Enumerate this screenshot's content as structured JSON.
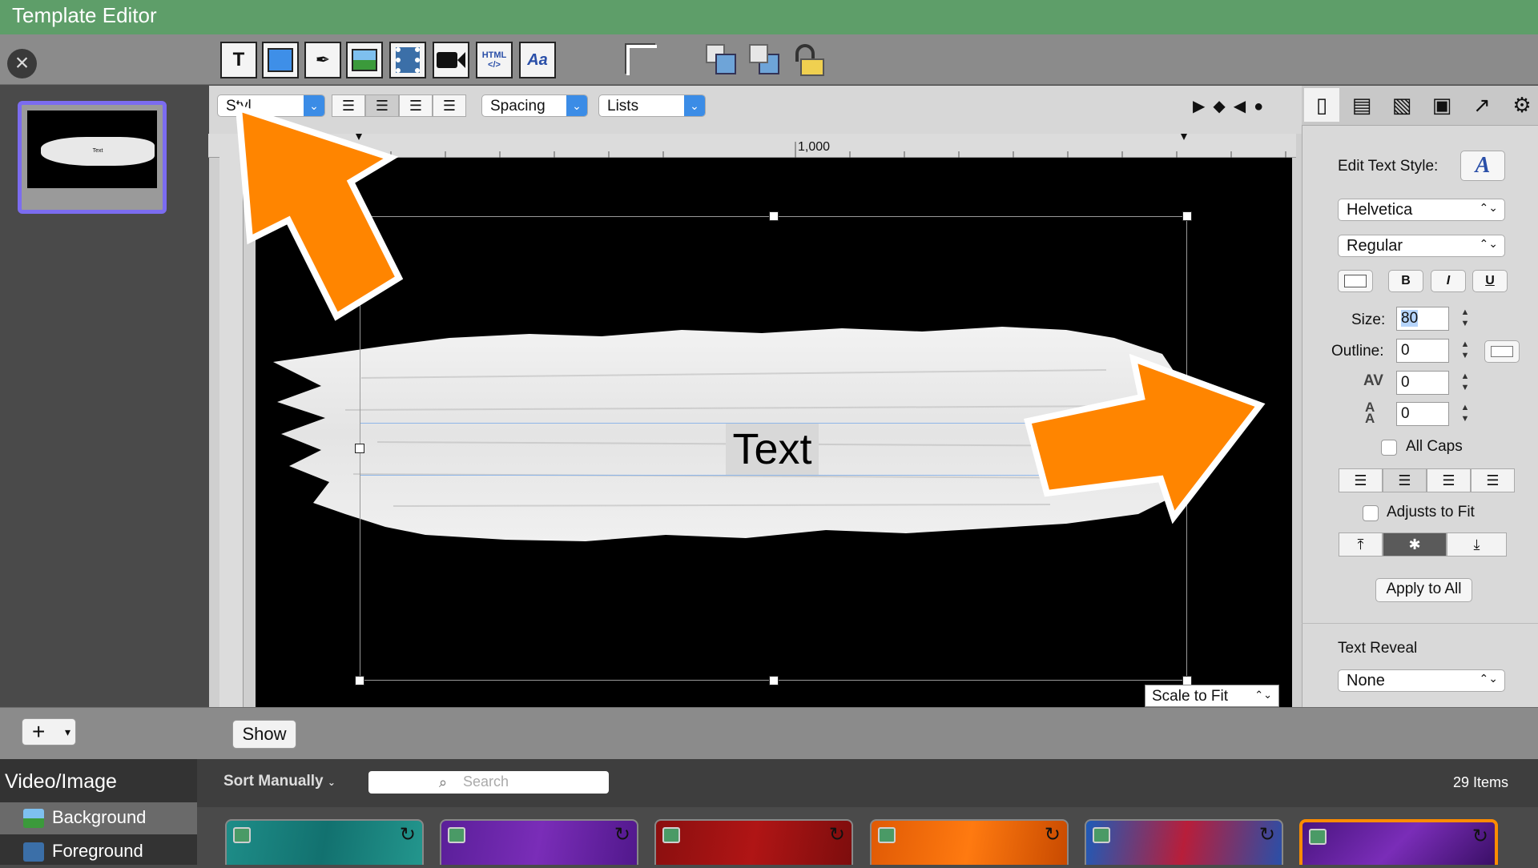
{
  "window": {
    "title": "Template Editor"
  },
  "toolbar": {
    "tools": [
      {
        "name": "text-tool-icon",
        "glyph": "T"
      },
      {
        "name": "shape-tool-icon",
        "glyph": "■"
      },
      {
        "name": "pen-tool-icon",
        "glyph": "✒"
      },
      {
        "name": "image-tool-icon",
        "glyph": "▣"
      },
      {
        "name": "video-tool-icon",
        "glyph": "▤"
      },
      {
        "name": "camera-tool-icon",
        "glyph": "■"
      },
      {
        "name": "html-tool-icon",
        "glyph": "HTML"
      },
      {
        "name": "text-style-tool-icon",
        "glyph": "Aa"
      }
    ]
  },
  "format_bar": {
    "style_label": "Styl",
    "spacing_label": "Spacing",
    "lists_label": "Lists",
    "ruler_mark": "1,000"
  },
  "canvas": {
    "text_object": "Text",
    "scale_mode": "Scale to Fit"
  },
  "inspector": {
    "edit_text_style_label": "Edit Text Style:",
    "font": "Helvetica",
    "weight": "Regular",
    "size_label": "Size:",
    "size_value": "80",
    "outline_label": "Outline:",
    "outline_value": "0",
    "kerning_value": "0",
    "leading_value": "0",
    "all_caps_label": "All Caps",
    "adjusts_to_fit_label": "Adjusts to Fit",
    "apply_all_label": "Apply to All",
    "text_reveal_label": "Text Reveal",
    "text_reveal_value": "None"
  },
  "bottom": {
    "show_label": "Show"
  },
  "library": {
    "title": "Video/Image",
    "sort_label": "Sort Manually",
    "search_placeholder": "Search",
    "item_count": "29 Items",
    "categories": [
      "Background",
      "Foreground"
    ]
  },
  "colors": {
    "title_bar": "#5e9e69",
    "selection_accent": "#7b6cf0",
    "arrow": "#ff8500",
    "dropdown_accent": "#3b8ce6"
  }
}
